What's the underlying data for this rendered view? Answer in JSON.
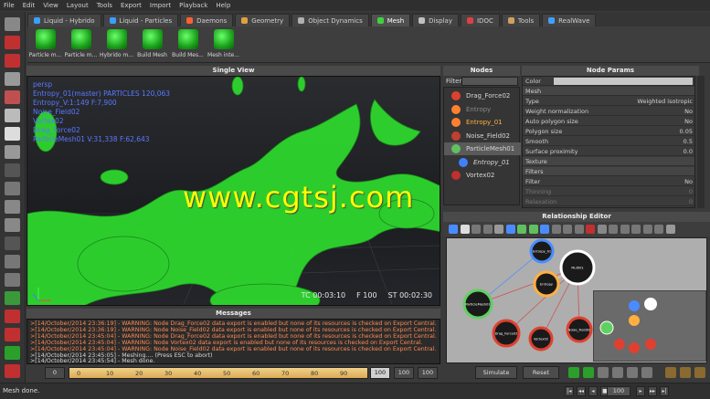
{
  "menu": [
    "File",
    "Edit",
    "View",
    "Layout",
    "Tools",
    "Export",
    "Import",
    "Playback",
    "Help"
  ],
  "tabs": [
    {
      "label": "Liquid - Hybrido",
      "color": "#3aa0ff"
    },
    {
      "label": "Liquid - Particles",
      "color": "#3aa0ff"
    },
    {
      "label": "Daemons",
      "color": "#ff6030"
    },
    {
      "label": "Geometry",
      "color": "#e0a040"
    },
    {
      "label": "Object Dynamics",
      "color": "#b0b0b0"
    },
    {
      "label": "Mesh",
      "color": "#40d040",
      "active": true
    },
    {
      "label": "Display",
      "color": "#c0c0c0"
    },
    {
      "label": "IDOC",
      "color": "#e04040"
    },
    {
      "label": "Tools",
      "color": "#d0a060"
    },
    {
      "label": "RealWave",
      "color": "#40a0ff"
    }
  ],
  "shelf": [
    "Particle m...",
    "Particle m...",
    "Hybrido m...",
    "Build Mesh",
    "Build Mes...",
    "Mesh inte..."
  ],
  "viewport": {
    "title": "Single View",
    "overlay": [
      "persp",
      "Entropy_01(master) PARTICLES 120,063",
      "Entropy_V:1:149 F:7,900",
      "Noise_Field02",
      "Vortex02",
      "Drag_Force02",
      "ParticleMesh01 V:31,338 F:62,643"
    ],
    "tc": "TC 00:03:10",
    "frame": "F 100",
    "st": "ST 00:02:30",
    "watermark": "www.cgtsj.com"
  },
  "nodes": {
    "title": "Nodes",
    "filter_label": "Filter",
    "items": [
      {
        "label": "Drag_Force02",
        "color": "#e04030",
        "dim": false
      },
      {
        "label": "Entropy",
        "color": "#ff8030",
        "dim": true
      },
      {
        "label": "Entropy_01",
        "color": "#ff8030",
        "dim": false,
        "accent": "#ffb040"
      },
      {
        "label": "Noise_Field02",
        "color": "#c04030",
        "dim": false
      },
      {
        "label": "ParticleMesh01",
        "color": "#60c060",
        "dim": false,
        "selected": true
      },
      {
        "label": "Entropy_01",
        "color": "#4080ff",
        "dim": false,
        "italic": true
      },
      {
        "label": "Vortex02",
        "color": "#c03030",
        "dim": false
      }
    ]
  },
  "params": {
    "title": "Node Params",
    "rows": [
      {
        "label": "Color",
        "value": "",
        "type": "color"
      },
      {
        "label": "Mesh",
        "value": "",
        "type": "section"
      },
      {
        "label": "Type",
        "value": "Weighted isotropic"
      },
      {
        "label": "Weight normalization",
        "value": "No"
      },
      {
        "label": "Auto polygon size",
        "value": "No"
      },
      {
        "label": "Polygon size",
        "value": "0.05"
      },
      {
        "label": "Smooth",
        "value": "0.5"
      },
      {
        "label": "Surface proximity",
        "value": "0.0"
      },
      {
        "label": "Texture",
        "value": "",
        "type": "section"
      },
      {
        "label": "Filters",
        "value": "",
        "type": "section"
      },
      {
        "label": "Filter",
        "value": "No"
      },
      {
        "label": "Thinning",
        "value": "0",
        "type": "dim"
      },
      {
        "label": "Relaxation",
        "value": "0",
        "type": "dim"
      }
    ]
  },
  "relationship": {
    "title": "Relationship Editor",
    "nodes": [
      {
        "label": "Entropy_01",
        "ring": "#4a8cff",
        "inner": "#ffcc30"
      },
      {
        "label": "Multi01",
        "ring": "#ffffff",
        "inner": "#ffffff"
      },
      {
        "label": "Entropy",
        "ring": "#ffb040",
        "inner": "#ffb040"
      },
      {
        "label": "ParticleMesh01",
        "ring": "#60d060",
        "inner": "#ffffff"
      },
      {
        "label": "Drag_Force02",
        "ring": "#e04030",
        "inner": "#e04030"
      },
      {
        "label": "Vortex02",
        "ring": "#e04030",
        "inner": "#e04030"
      },
      {
        "label": "Noise_Field02",
        "ring": "#e04030",
        "inner": "#e04030"
      }
    ]
  },
  "messages": {
    "title": "Messages",
    "lines": [
      {
        "text": ">[14/October/2014 23:36:19] - WARNING: Node Drag_Force02 data export is enabled but none of its resources is checked on Export Central.",
        "warn": true
      },
      {
        "text": ">[14/October/2014 23:36:19] - WARNING: Node Noise_Field02 data export is enabled but none of its resources is checked on Export Central.",
        "warn": true
      },
      {
        "text": ">[14/October/2014 23:45:04] - WARNING: Node Drag_Force02 data export is enabled but none of its resources is checked on Export Central.",
        "warn": true
      },
      {
        "text": ">[14/October/2014 23:45:04] - WARNING: Node Vortex02 data export is enabled but none of its resources is checked on Export Central.",
        "warn": true
      },
      {
        "text": ">[14/October/2014 23:45:04] - WARNING: Node Noise_Field02 data export is enabled but none of its resources is checked on Export Central.",
        "warn": true
      },
      {
        "text": ">[14/October/2014 23:45:05] - Meshing.... (Press ESC to abort)",
        "warn": false
      },
      {
        "text": ">[14/October/2014 23:45:54] - Mesh done.",
        "warn": false
      }
    ]
  },
  "timeline": {
    "start": "0",
    "ticks": [
      "0",
      "10",
      "20",
      "30",
      "40",
      "50",
      "60",
      "70",
      "80",
      "90"
    ],
    "current": "100",
    "end1": "100",
    "end2": "100"
  },
  "controls": {
    "simulate": "Simulate",
    "reset": "Reset",
    "frame": "100"
  },
  "status": "Mesh done."
}
